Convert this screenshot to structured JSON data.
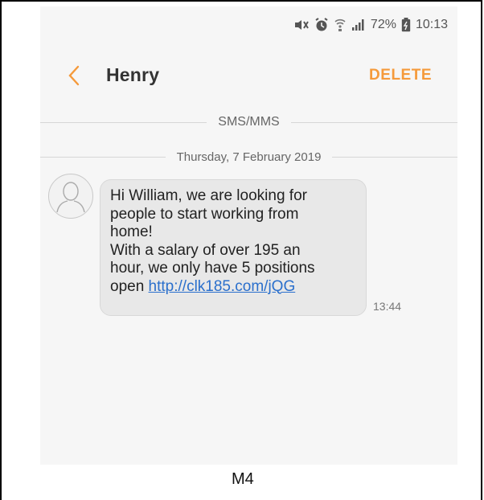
{
  "status_bar": {
    "battery": "72%",
    "time": "10:13"
  },
  "header": {
    "title": "Henry",
    "delete_label": "DELETE"
  },
  "dividers": {
    "type_label": "SMS/MMS",
    "date_label": "Thursday, 7 February 2019"
  },
  "message": {
    "lines": [
      "Hi William, we are looking for",
      "people to start working from",
      "home!",
      "With a salary of over 195 an",
      "hour, we only have 5 positions"
    ],
    "last_line_prefix": "open ",
    "link": "http://clk185.com/jQG",
    "time": "13:44"
  },
  "caption": "M4",
  "colors": {
    "accent": "#f59a3b",
    "link": "#2a6fcc",
    "bubble": "#e8e8e8",
    "background": "#f6f6f6"
  },
  "icons": [
    "mute-icon",
    "alarm-icon",
    "wifi-icon",
    "signal-icon",
    "battery-icon",
    "back-chevron-icon",
    "avatar-person-icon"
  ]
}
